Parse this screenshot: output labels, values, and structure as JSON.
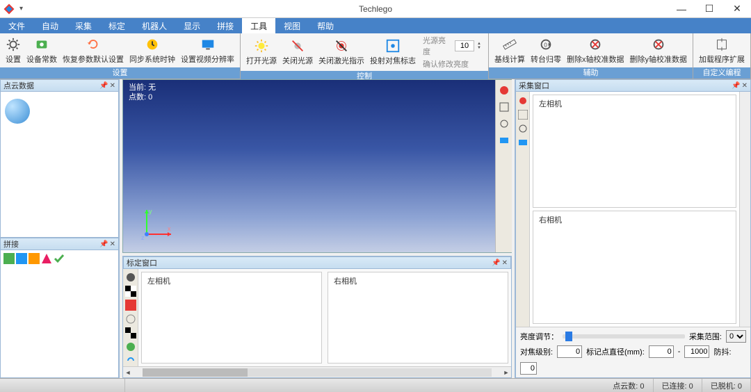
{
  "app": {
    "title": "Techlego"
  },
  "window_controls": {
    "min": "—",
    "max": "☐",
    "close": "✕"
  },
  "menu": {
    "items": [
      "文件",
      "自动",
      "采集",
      "标定",
      "机器人",
      "显示",
      "拼接",
      "工具",
      "视图",
      "帮助"
    ],
    "active_index": 7
  },
  "ribbon": {
    "groups": [
      {
        "label": "设置",
        "buttons": [
          {
            "icon": "gear-icon",
            "label": "设置"
          },
          {
            "icon": "device-icon",
            "label": "设备常数"
          },
          {
            "icon": "restore-icon",
            "label": "恢复参数默认设置"
          },
          {
            "icon": "clock-icon",
            "label": "同步系统时钟"
          },
          {
            "icon": "monitor-icon",
            "label": "设置视频分辨率"
          }
        ]
      },
      {
        "label": "控制",
        "buttons": [
          {
            "icon": "light-on-icon",
            "label": "打开光源"
          },
          {
            "icon": "light-off-icon",
            "label": "关闭光源"
          },
          {
            "icon": "laser-off-icon",
            "label": "关闭激光指示"
          },
          {
            "icon": "focus-target-icon",
            "label": "投射对焦标志"
          }
        ],
        "brightness": {
          "label": "光源亮度",
          "value": "10",
          "confirm": "确认修改亮度"
        }
      },
      {
        "label": "辅助",
        "buttons": [
          {
            "icon": "ruler-icon",
            "label": "基线计算"
          },
          {
            "icon": "rotate-zero-icon",
            "label": "转台归零"
          },
          {
            "icon": "delete-x-cal-icon",
            "label": "删除x轴校准数据"
          },
          {
            "icon": "delete-y-cal-icon",
            "label": "删除y轴校准数据"
          }
        ]
      },
      {
        "label": "自定义编程",
        "buttons": [
          {
            "icon": "plugin-icon",
            "label": "加载程序扩展"
          }
        ]
      }
    ]
  },
  "panels": {
    "point_cloud": {
      "title": "点云数据"
    },
    "stitch": {
      "title": "拼接"
    },
    "view3d": {
      "current_label": "当前: 无",
      "points_label": "点数: 0"
    },
    "calibration": {
      "title": "标定窗口",
      "left_cam": "左相机",
      "right_cam": "右相机"
    },
    "capture": {
      "title": "采集窗口",
      "left_cam": "左相机",
      "right_cam": "右相机",
      "brightness_label": "亮度调节：",
      "range_label": "采集范围:",
      "range_value": "0",
      "focus_level_label": "对焦级别:",
      "focus_level_value": "0",
      "marker_diameter_label": "标记点直径(mm):",
      "marker_min": "0",
      "marker_max": "1000",
      "anti_shake_label": "防抖:",
      "anti_shake_value": "0"
    }
  },
  "statusbar": {
    "points": "点云数: 0",
    "connected": "已连接: 0",
    "offline": "已脱机: 0"
  }
}
